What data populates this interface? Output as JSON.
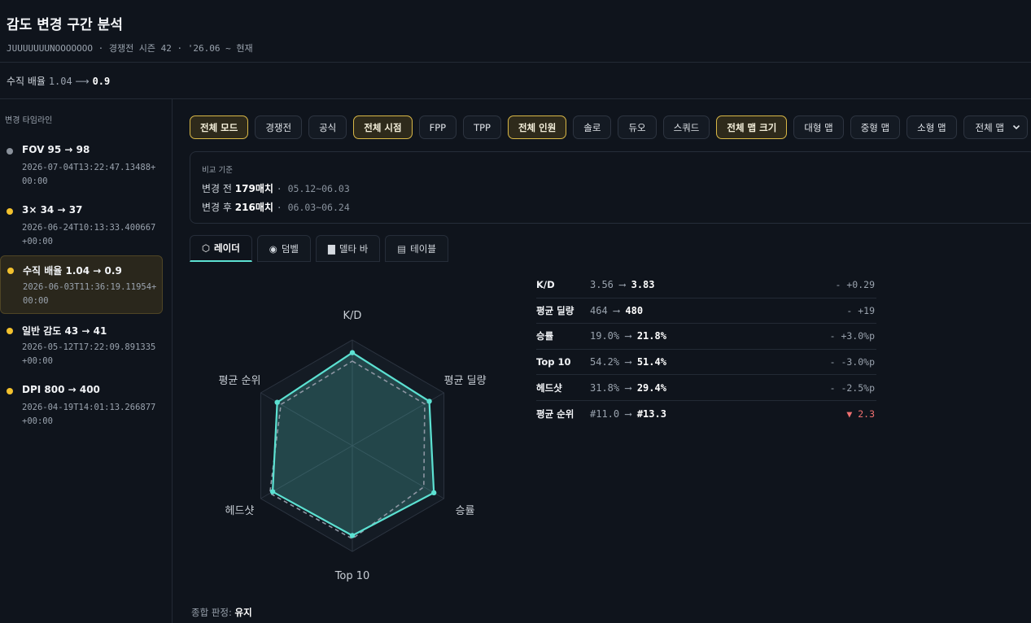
{
  "header": {
    "title": "감도 변경 구간 분석",
    "subtitle": "JUUUUUUUNOOOOOOO · 경쟁전 시즌 42 · '26.06 ~ 현재"
  },
  "setting": {
    "label": "수직 배율",
    "before": "1.04",
    "arrow": "⟶",
    "after": "0.9"
  },
  "sidebar": {
    "title": "변경 타임라인",
    "items": [
      {
        "label": "FOV 95 → 98",
        "timestamp": "2026-07-04T13:22:47.13488+00:00",
        "dot_color": "#8a919b"
      },
      {
        "label": "3× 34 → 37",
        "timestamp": "2026-06-24T10:13:33.400667+00:00",
        "dot_color": "#f2c12e"
      },
      {
        "label": "수직 배율 1.04 → 0.9",
        "timestamp": "2026-06-03T11:36:19.11954+00:00",
        "dot_color": "#f2c12e"
      },
      {
        "label": "일반 감도 43 → 41",
        "timestamp": "2026-05-12T17:22:09.891335+00:00",
        "dot_color": "#f2c12e"
      },
      {
        "label": "DPI 800 → 400",
        "timestamp": "2026-04-19T14:01:13.266877+00:00",
        "dot_color": "#f2c12e"
      }
    ]
  },
  "filters": {
    "chips": [
      {
        "label": "전체 모드",
        "active": true
      },
      {
        "label": "경쟁전",
        "active": false
      },
      {
        "label": "공식",
        "active": false
      },
      {
        "label": "전체 시점",
        "active": true
      },
      {
        "label": "FPP",
        "active": false
      },
      {
        "label": "TPP",
        "active": false
      },
      {
        "label": "전체 인원",
        "active": true
      },
      {
        "label": "솔로",
        "active": false
      },
      {
        "label": "듀오",
        "active": false
      },
      {
        "label": "스쿼드",
        "active": false
      },
      {
        "label": "전체 맵 크기",
        "active": true
      },
      {
        "label": "대형 맵",
        "active": false
      },
      {
        "label": "중형 맵",
        "active": false
      },
      {
        "label": "소형 맵",
        "active": false
      }
    ],
    "map_select": "전체 맵"
  },
  "compare": {
    "title": "비교 기준",
    "before": {
      "label": "변경 전",
      "matches": "179매치",
      "range": "05.12~06.03"
    },
    "after": {
      "label": "변경 후",
      "matches": "216매치",
      "range": "06.03~06.24"
    }
  },
  "tabs": [
    {
      "label": "레이더",
      "icon": "radar-icon",
      "glyph": "⬡"
    },
    {
      "label": "덤벨",
      "icon": "dumbbell-icon",
      "glyph": "◉"
    },
    {
      "label": "델타 바",
      "icon": "bar-icon",
      "glyph": "▇"
    },
    {
      "label": "테이블",
      "icon": "table-icon",
      "glyph": "▤"
    }
  ],
  "chart_data": {
    "type": "radar",
    "axes": [
      "K/D",
      "평균 딜량",
      "승률",
      "Top 10",
      "헤드샷",
      "평균 순위"
    ],
    "series": [
      {
        "values": [
          0.88,
          0.84,
          0.89,
          0.85,
          0.87,
          0.82
        ],
        "color": "#5ce1d2",
        "style": "solid"
      },
      {
        "values": [
          0.8,
          0.79,
          0.78,
          0.88,
          0.9,
          0.78
        ],
        "color": "#8e96a3",
        "style": "dashed"
      }
    ],
    "rings": 4
  },
  "metrics": [
    {
      "name": "K/D",
      "before": "3.56",
      "after": "3.83",
      "delta": "- +0.29",
      "bad": false
    },
    {
      "name": "평균 딜량",
      "before": "464",
      "after": "480",
      "delta": "- +19",
      "bad": false
    },
    {
      "name": "승률",
      "before": "19.0%",
      "after": "21.8%",
      "delta": "- +3.0%p",
      "bad": false
    },
    {
      "name": "Top 10",
      "before": "54.2%",
      "after": "51.4%",
      "delta": "- -3.0%p",
      "bad": false
    },
    {
      "name": "헤드샷",
      "before": "31.8%",
      "after": "29.4%",
      "delta": "- -2.5%p",
      "bad": false
    },
    {
      "name": "평균 순위",
      "before": "#11.0",
      "after": "#13.3",
      "delta": "▼ 2.3",
      "bad": true
    }
  ],
  "verdict": {
    "label": "종합 판정:",
    "value": "유지"
  }
}
